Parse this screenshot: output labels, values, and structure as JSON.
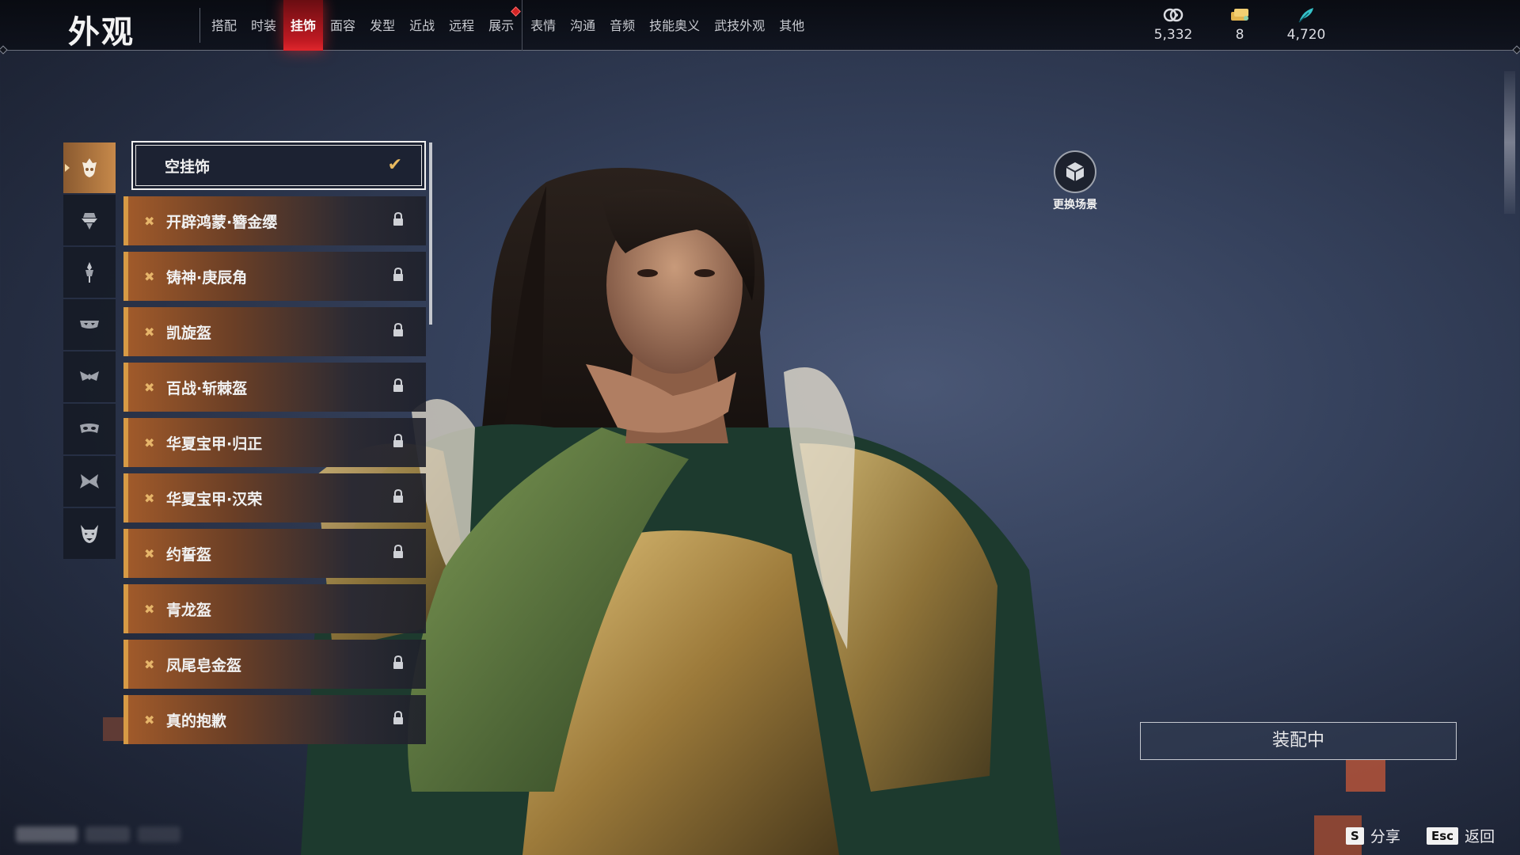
{
  "header": {
    "title": "外观",
    "tabs": [
      {
        "label": "搭配"
      },
      {
        "label": "时装"
      },
      {
        "label": "挂饰",
        "active": true
      },
      {
        "label": "面容"
      },
      {
        "label": "发型"
      },
      {
        "label": "近战"
      },
      {
        "label": "远程"
      },
      {
        "label": "展示",
        "badge": true
      },
      {
        "label": "表情"
      },
      {
        "label": "沟通"
      },
      {
        "label": "音频"
      },
      {
        "label": "技能奥义"
      },
      {
        "label": "武技外观"
      },
      {
        "label": "其他"
      }
    ],
    "currencies": [
      {
        "icon": "coin-stack-icon",
        "value": "5,332"
      },
      {
        "icon": "ticket-icon",
        "value": "8"
      },
      {
        "icon": "feather-icon",
        "value": "4,720"
      }
    ]
  },
  "categories": [
    {
      "icon": "headgear-icon",
      "active": true
    },
    {
      "icon": "hat-icon"
    },
    {
      "icon": "hairpin-icon"
    },
    {
      "icon": "face-mask-icon"
    },
    {
      "icon": "eye-mask-icon"
    },
    {
      "icon": "mask-icon"
    },
    {
      "icon": "butterfly-mask-icon"
    },
    {
      "icon": "demon-mask-icon"
    }
  ],
  "items": [
    {
      "name": "空挂饰",
      "selected": true,
      "equipped": true
    },
    {
      "name": "开辟鸿蒙·簪金缨",
      "locked": true
    },
    {
      "name": "铸神·庚辰角",
      "locked": true
    },
    {
      "name": "凯旋盔",
      "locked": true
    },
    {
      "name": "百战·斩棘盔",
      "locked": true
    },
    {
      "name": "华夏宝甲·归正",
      "locked": true
    },
    {
      "name": "华夏宝甲·汉荣",
      "locked": true
    },
    {
      "name": "约誓盔",
      "locked": true
    },
    {
      "name": "青龙盔",
      "locked": false
    },
    {
      "name": "凤尾皂金盔",
      "locked": true
    },
    {
      "name": "真的抱歉",
      "locked": true
    }
  ],
  "scene": {
    "label": "更换场景"
  },
  "equip_status": "装配中",
  "hints": [
    {
      "key": "S",
      "label": "分享"
    },
    {
      "key": "Esc",
      "label": "返回"
    }
  ]
}
